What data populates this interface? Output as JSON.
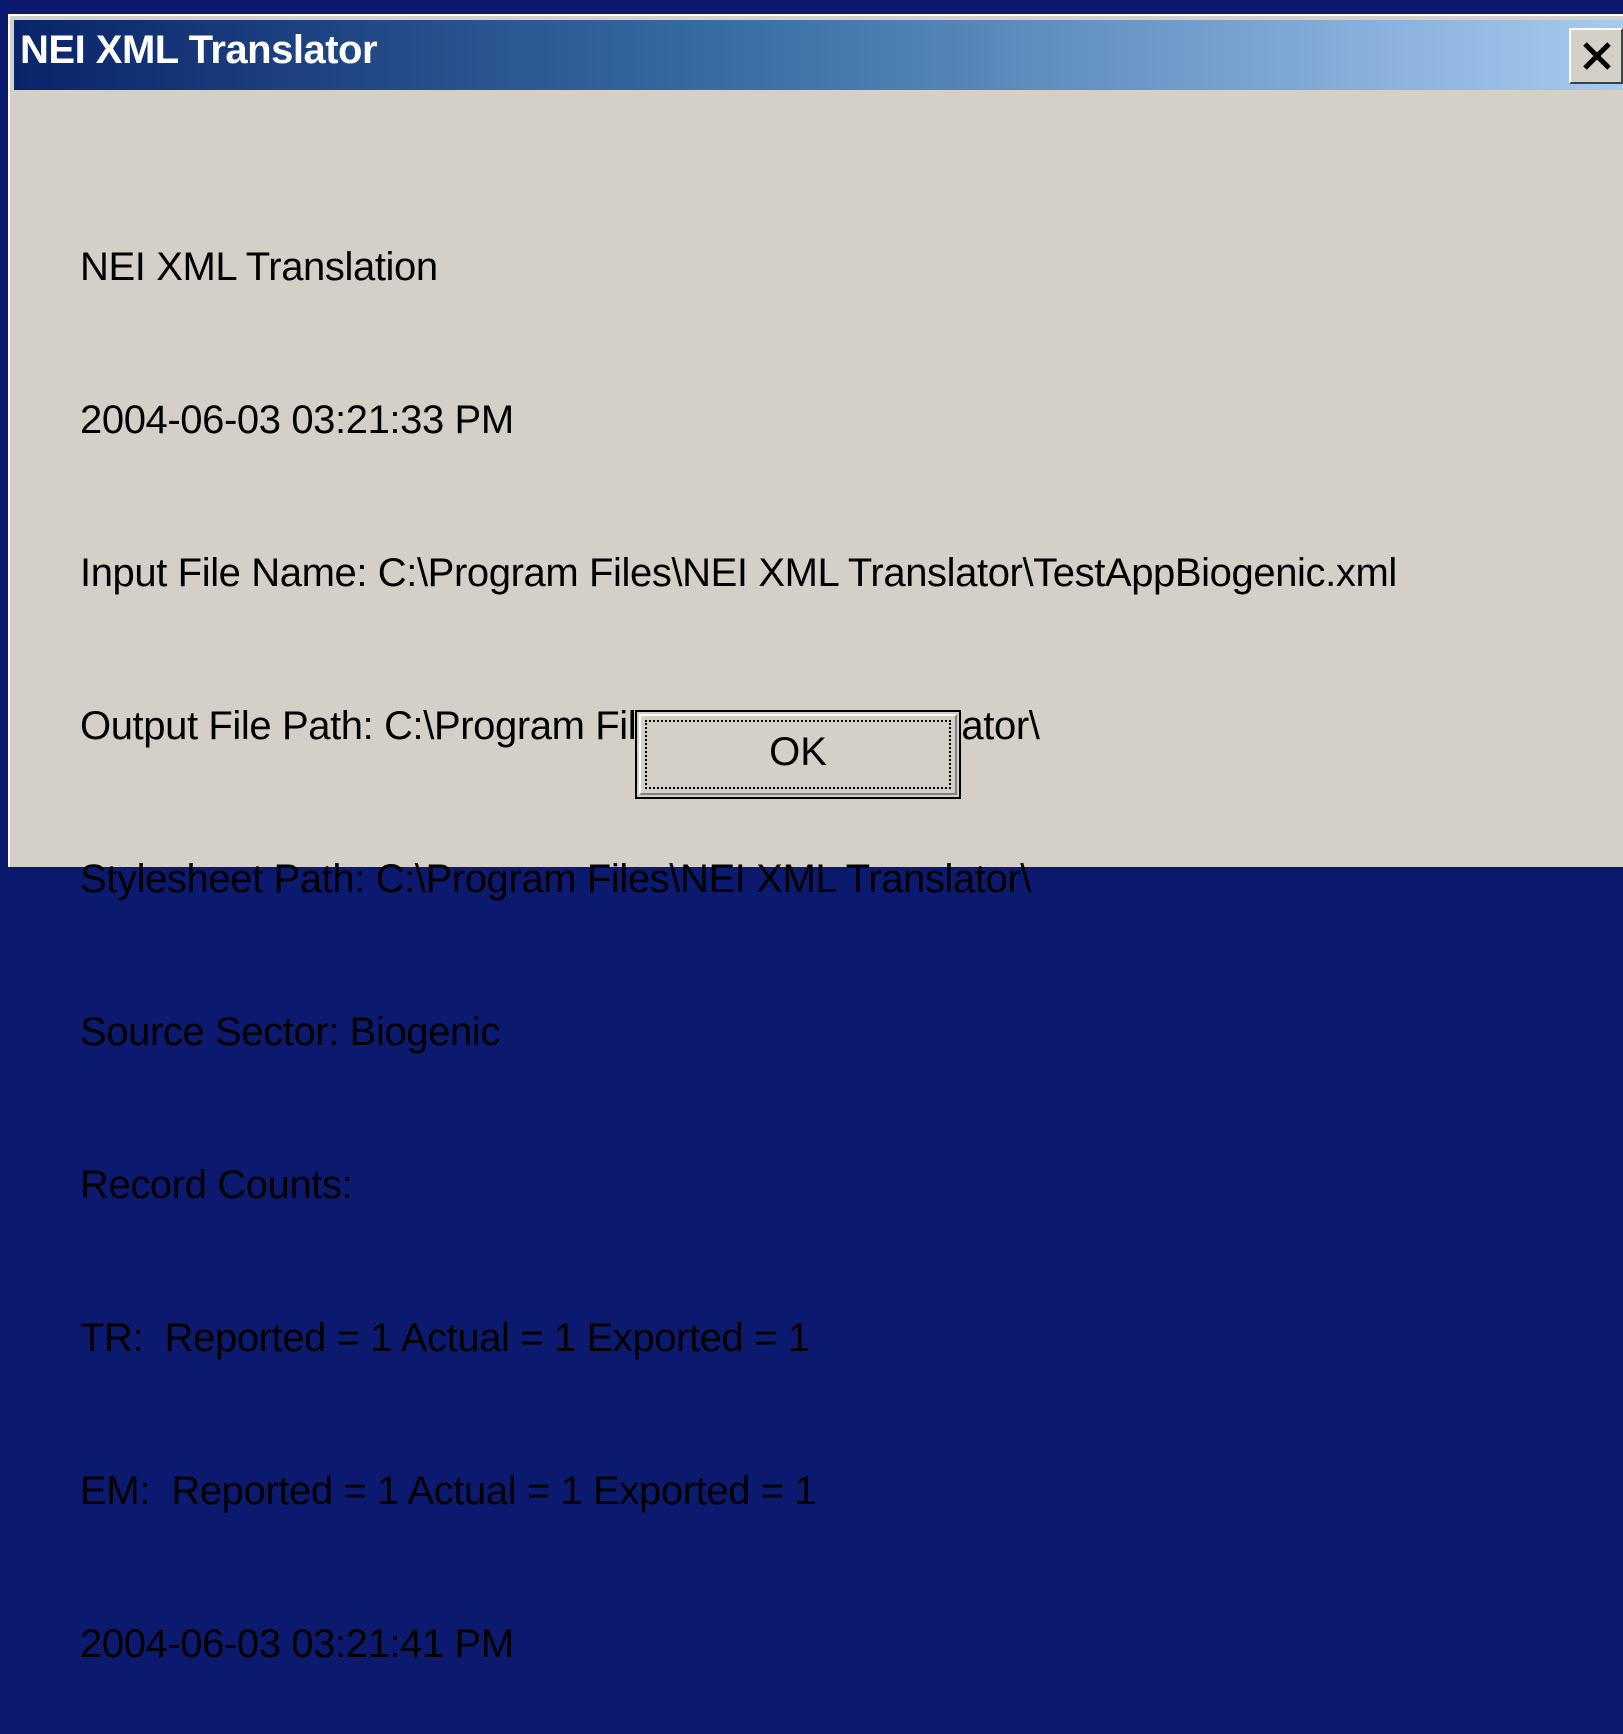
{
  "window": {
    "title": "NEI XML Translator"
  },
  "message_lines": [
    "NEI XML Translation",
    "2004-06-03 03:21:33 PM",
    "Input File Name: C:\\Program Files\\NEI XML Translator\\TestAppBiogenic.xml",
    "Output File Path: C:\\Program Files\\NEI XML Translator\\",
    "Stylesheet Path: C:\\Program Files\\NEI XML Translator\\",
    "Source Sector: Biogenic",
    "Record Counts:",
    "TR:  Reported = 1 Actual = 1 Exported = 1",
    "EM:  Reported = 1 Actual = 1 Exported = 1",
    "2004-06-03 03:21:41 PM"
  ],
  "buttons": {
    "ok_label": "OK"
  },
  "icons": {
    "close": "close-icon"
  },
  "colors": {
    "title_gradient_start": "#0a246a",
    "title_gradient_end": "#a6caf0",
    "dialog_face": "#d4d0c8",
    "desktop": "#0b1a6e"
  }
}
